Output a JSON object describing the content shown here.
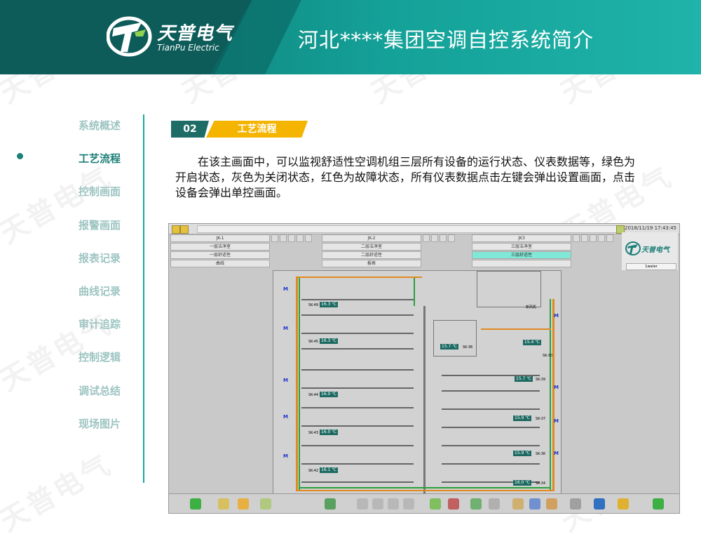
{
  "header": {
    "logo_cn": "天普电气",
    "logo_en": "TianPu Electric",
    "title": "河北****集团空调自控系统简介"
  },
  "sidebar": {
    "items": [
      {
        "label": "系统概述",
        "active": false
      },
      {
        "label": "工艺流程",
        "active": true
      },
      {
        "label": "控制画面",
        "active": false
      },
      {
        "label": "报警画面",
        "active": false
      },
      {
        "label": "报表记录",
        "active": false
      },
      {
        "label": "曲线记录",
        "active": false
      },
      {
        "label": "审计追踪",
        "active": false
      },
      {
        "label": "控制逻辑",
        "active": false
      },
      {
        "label": "调试总结",
        "active": false
      },
      {
        "label": "现场图片",
        "active": false
      }
    ]
  },
  "section": {
    "number": "02",
    "label": "工艺流程",
    "description": "在该主画面中，可以监视舒适性空调机组三层所有设备的运行状态、仪表数据等，绿色为开启状态，灰色为关闭状态，红色为故障状态，所有仪表数据点击左键会弹出设置画面，点击设备会弹出单控画面。"
  },
  "scada": {
    "timestamp": "2018/11/19 17:43:45",
    "user": "1water",
    "logo_text": "天普电气",
    "columns": [
      {
        "header": "JK-1",
        "rows": [
          "一层洁净室",
          "一层舒适性"
        ]
      },
      {
        "header": "JK-2",
        "rows": [
          "二层洁净室",
          "二层舒适性"
        ]
      },
      {
        "header": "JK3",
        "rows": [
          "三层洁净室",
          "三层舒适性"
        ]
      }
    ],
    "bottom_row": [
      "曲线",
      "报表"
    ],
    "left_units": [
      {
        "id": "SK-49",
        "value": "16.3 ℃"
      },
      {
        "id": "SK-45",
        "value": "16.3 ℃"
      },
      {
        "id": "SK-44",
        "value": "16.0 ℃"
      },
      {
        "id": "SK-43",
        "value": "16.0 ℃"
      },
      {
        "id": "SK-42",
        "value": "16.1 ℃"
      }
    ],
    "right_units": [
      {
        "id": "SK-38",
        "value": "15.7 ℃"
      },
      {
        "id": "SK-30",
        "value": "15.4 ℃"
      },
      {
        "id": "SK-39",
        "value": "15.7 ℃"
      },
      {
        "id": "SK-37",
        "value": "15.9 ℃"
      },
      {
        "id": "SK-36",
        "value": "15.9 ℃"
      },
      {
        "id": "SK-34",
        "value": "16.0 ℃"
      }
    ],
    "room_label": "新风机",
    "motor_mark": "M"
  },
  "watermark": "天普电气",
  "colors": {
    "accent": "#1aa59c",
    "badge_num": "#1e6c66",
    "badge_label": "#f4b400",
    "tag": "#1d6a62"
  }
}
